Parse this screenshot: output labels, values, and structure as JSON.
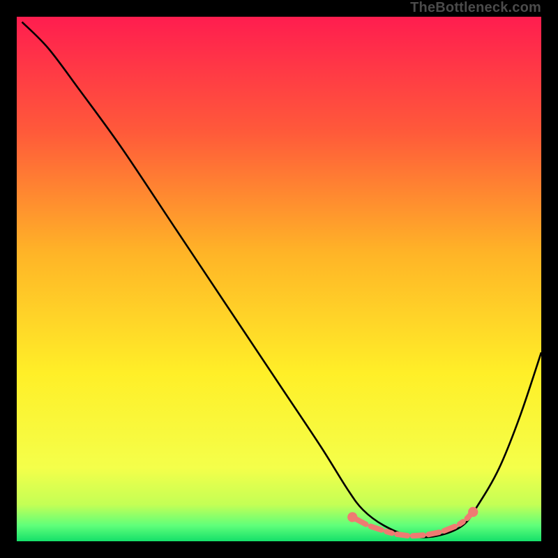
{
  "watermark": "TheBottleneck.com",
  "chart_data": {
    "type": "line",
    "title": "",
    "xlabel": "",
    "ylabel": "",
    "xlim": [
      0,
      100
    ],
    "ylim": [
      0,
      100
    ],
    "grid": false,
    "legend": false,
    "background": {
      "type": "vertical-gradient",
      "stops": [
        {
          "offset": 0,
          "color": "#ff1d4f"
        },
        {
          "offset": 22,
          "color": "#ff5a3a"
        },
        {
          "offset": 45,
          "color": "#ffb427"
        },
        {
          "offset": 68,
          "color": "#ffef28"
        },
        {
          "offset": 86,
          "color": "#f4ff4a"
        },
        {
          "offset": 93,
          "color": "#c4ff55"
        },
        {
          "offset": 97,
          "color": "#5fff7a"
        },
        {
          "offset": 100,
          "color": "#15e06a"
        }
      ]
    },
    "series": [
      {
        "name": "bottleneck-curve",
        "color": "#000000",
        "x": [
          1,
          6,
          12,
          20,
          30,
          40,
          50,
          58,
          63,
          66,
          70,
          75,
          80,
          85,
          88,
          92,
          96,
          100
        ],
        "y": [
          99,
          94,
          86,
          75,
          60,
          45,
          30,
          18,
          10,
          6,
          3,
          1,
          1,
          3,
          7,
          14,
          24,
          36
        ]
      }
    ],
    "markers": {
      "name": "optimal-range",
      "color": "#ef7b72",
      "style": "dashed-dots",
      "x": [
        64,
        67,
        70,
        72,
        75,
        78,
        81,
        84,
        85.5,
        87
      ],
      "y": [
        4.6,
        3.0,
        2.0,
        1.4,
        1.0,
        1.2,
        1.8,
        3.0,
        4.0,
        5.6
      ]
    }
  }
}
